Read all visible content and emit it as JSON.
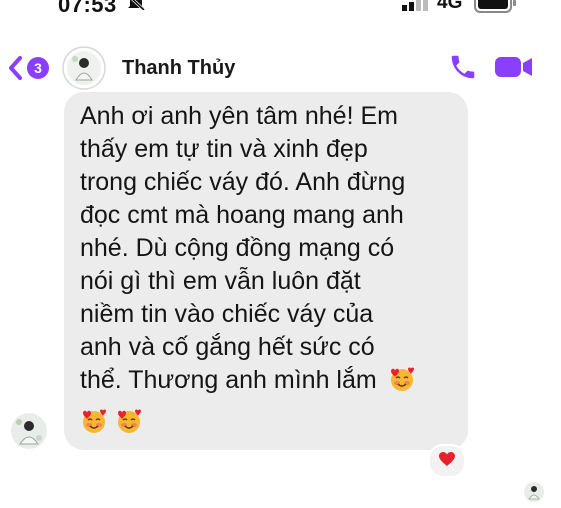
{
  "status_bar": {
    "time": "07:53",
    "network": "4G",
    "icons": [
      "mute-icon",
      "signal-icon",
      "battery-icon"
    ]
  },
  "header": {
    "back_badge": "3",
    "contact_name": "Thanh Thủy",
    "icons": [
      "chevron-left-icon",
      "phone-icon",
      "video-camera-icon"
    ]
  },
  "message": {
    "lines": [
      "Anh ơi anh yên tâm nhé! Em",
      "thấy em tự tin và xinh đẹp",
      "trong chiếc váy đó. Anh đừng",
      "đọc cmt mà hoang mang anh",
      "nhé. Dù cộng đồng mạng có",
      "nói gì thì em vẫn luôn đặt",
      "niềm tin vào chiếc váy của",
      "anh và cố gắng hết sức có",
      "thể. Thương anh mình lắm"
    ],
    "emojis": [
      "smiling-face-with-hearts-icon",
      "smiling-face-with-hearts-icon",
      "smiling-face-with-hearts-icon"
    ],
    "reaction": "heart-icon"
  },
  "colors": {
    "accent": "#8a3ffc",
    "bubble": "#ececec",
    "heart": "#e8212d"
  }
}
